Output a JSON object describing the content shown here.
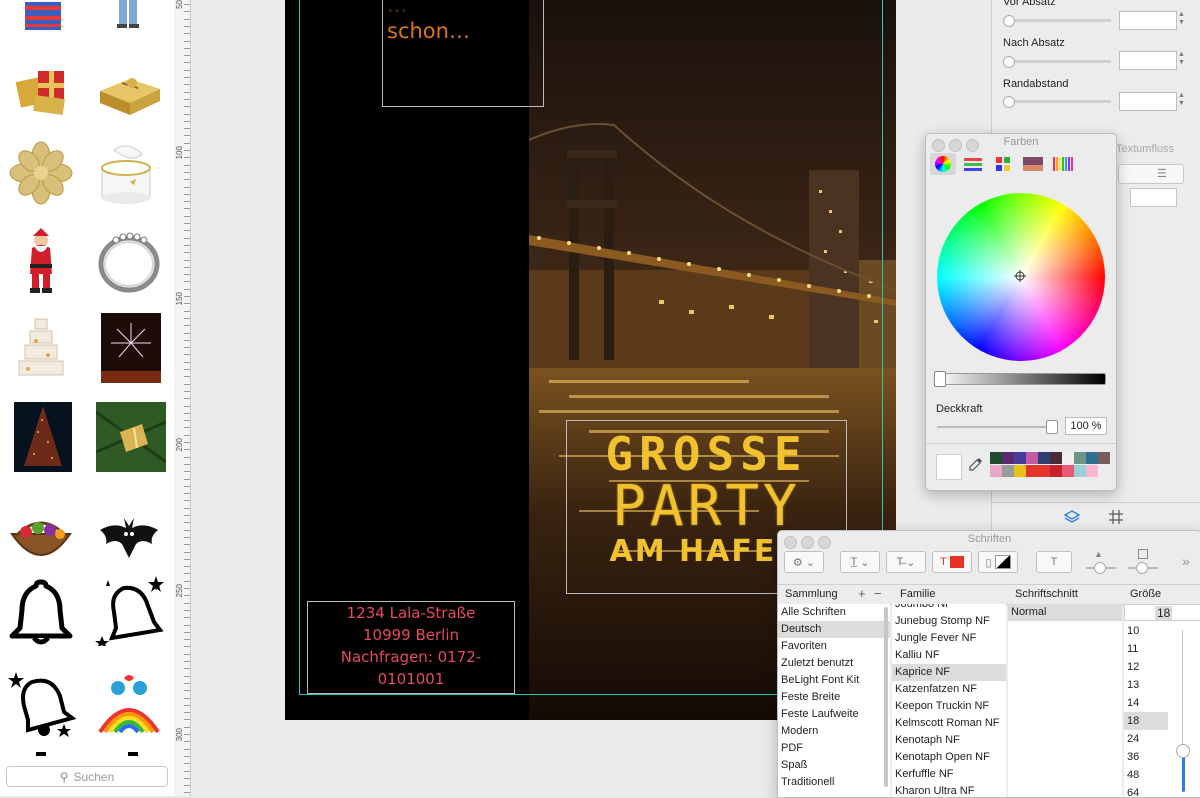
{
  "clipart": {
    "search_placeholder": "Suchen",
    "items": [
      "shirt",
      "jeans",
      "red-gift",
      "gold-gift",
      "gold-bow",
      "gift-box-round",
      "santa",
      "ring",
      "wedding-cake",
      "fireworks",
      "christmas-tree",
      "gift-in-tree",
      "fruit-basket",
      "bat",
      "bell-outline",
      "bells-stars",
      "bell-stars",
      "rainbow-birds"
    ]
  },
  "ruler": {
    "labels": [
      "50",
      "100",
      "150",
      "200",
      "250",
      "300"
    ]
  },
  "document": {
    "teaser_lines": [
      "...",
      "schon…"
    ],
    "party_lines": [
      "GROSSE",
      "PARTY",
      "AM HAFEN"
    ],
    "address_lines": [
      "1234 Lala-Straße",
      "10999 Berlin",
      "Nachfragen: 0172-0101001"
    ]
  },
  "inspector": {
    "vor_absatz": "Vor Absatz",
    "nach_absatz": "Nach Absatz",
    "randabstand": "Randabstand",
    "textumfluss": "Textumfluss"
  },
  "colors_panel": {
    "title": "Farben",
    "opacity_label": "Deckkraft",
    "opacity_value": "100 %",
    "swatches": [
      "#1f4d2b",
      "#5b2a6e",
      "#4a3b9a",
      "#c25ba1",
      "#2f3f72",
      "#4b2a3a",
      "#f0f0f0",
      "#6d9484",
      "#2f6f8f",
      "#7a5c5a",
      "#e8a6c8",
      "#9a9a9a",
      "#e8c21a",
      "#e3352b",
      "#e3352b",
      "#c7222b",
      "#e85a78",
      "#9ad0d8",
      "#f7b6d2"
    ]
  },
  "fonts_panel": {
    "title": "Schriften",
    "headers": {
      "collection": "Sammlung",
      "family": "Familie",
      "typeface": "Schriftschnitt",
      "size": "Größe"
    },
    "collections": [
      "Alle Schriften",
      "Deutsch",
      "Favoriten",
      "Zuletzt benutzt",
      "BeLight Font Kit",
      "Feste Breite",
      "Feste Laufweite",
      "Modern",
      "PDF",
      "Spaß",
      "Traditionell"
    ],
    "selected_collection": "Deutsch",
    "families": [
      "Joumbo NF",
      "Junebug Stomp NF",
      "Jungle Fever NF",
      "Kalliu NF",
      "Kaprice NF",
      "Katzenfatzen NF",
      "Keepon Truckin NF",
      "Kelmscott Roman NF",
      "Kenotaph NF",
      "Kenotaph Open NF",
      "Kerfuffle NF",
      "Kharon Ultra NF"
    ],
    "selected_family": "Kaprice NF",
    "typefaces": [
      "Normal"
    ],
    "size_value": "18",
    "sizes": [
      "10",
      "11",
      "12",
      "13",
      "14",
      "18",
      "24",
      "36",
      "48",
      "64"
    ],
    "selected_size": "18"
  }
}
